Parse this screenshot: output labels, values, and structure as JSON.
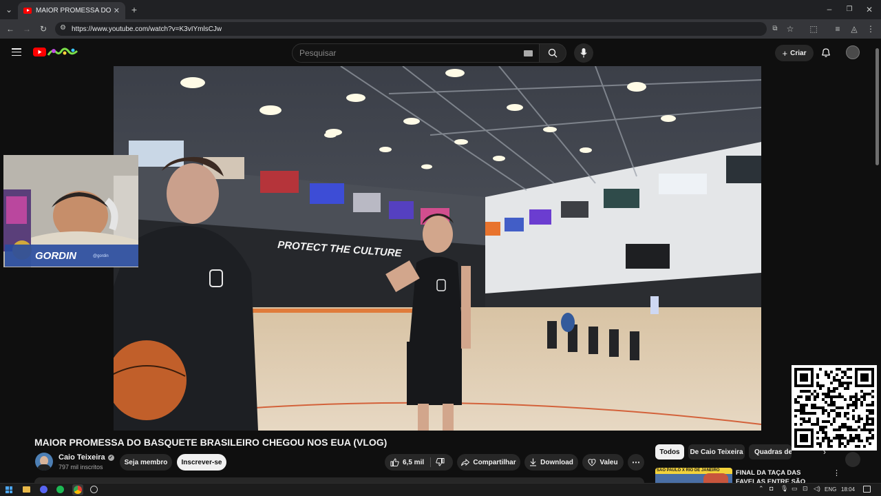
{
  "browser": {
    "tab_title": "MAIOR PROMESSA DO BASQUETE",
    "url": "https://www.youtube.com/watch?v=K3vIYmlsCJw"
  },
  "youtube": {
    "search_placeholder": "Pesquisar",
    "create_label": "Criar"
  },
  "video_overlay": {
    "banner_text": "PROTECT THE CULTURE",
    "streamer_name": "GORDIN",
    "streamer_handle": "@gordin"
  },
  "video": {
    "title": "MAIOR PROMESSA DO BASQUETE BRASILEIRO CHEGOU NOS EUA (VLOG)",
    "channel_name": "Caio Teixeira",
    "subscribers": "797 mil inscritos",
    "member_label": "Seja membro",
    "subscribe_label": "Inscrever-se",
    "likes": "6,5 mil",
    "share_label": "Compartilhar",
    "download_label": "Download",
    "thanks_label": "Valeu"
  },
  "sidebar": {
    "chips": [
      "Todos",
      "De Caio Teixeira",
      "Quadras de Basquete"
    ],
    "rec_title": "FINAL DA TAÇA DAS FAVELAS ENTRE SÃO PAULO VS RIO DE",
    "rec_thumb_text": "SÃO PAULO X RIO DE JANEIRO"
  },
  "taskbar": {
    "lang": "ENG",
    "time": "18:04"
  },
  "colors": {
    "accent_red": "#ff0000",
    "background": "#0f0f0f",
    "surface": "#272727"
  }
}
